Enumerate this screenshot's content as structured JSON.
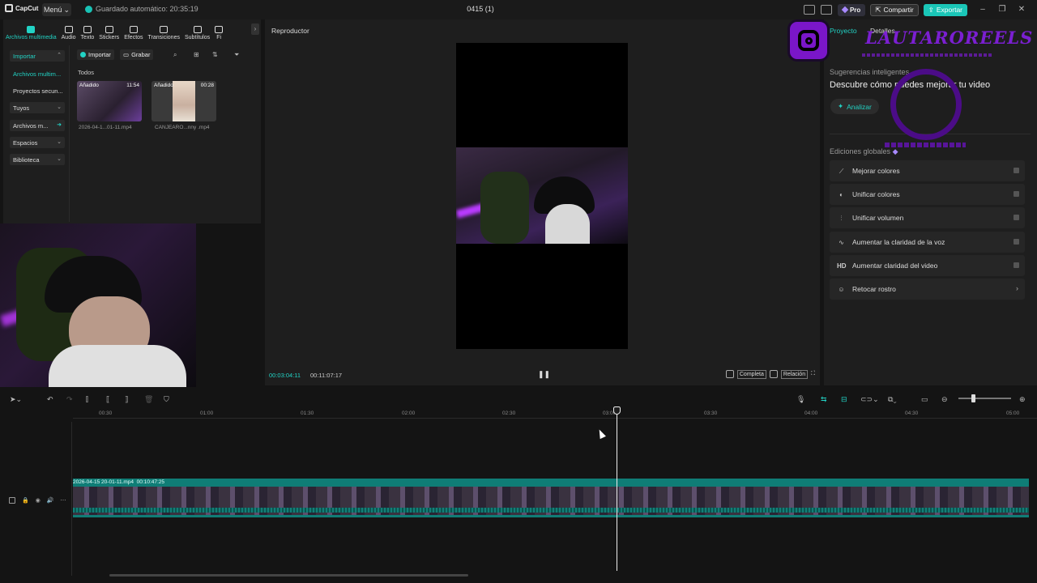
{
  "app": {
    "logo_text": "CapCut",
    "menu_label": "Menú",
    "autosave": "Guardado automático: 20:35:19",
    "doc_title": "0415 (1)",
    "pro_label": "Pro",
    "share_label": "Compartir",
    "export_label": "Exportar",
    "accent_color": "#22d3c5"
  },
  "tools": {
    "tabs": [
      {
        "label": "Archivos multimedia",
        "icon": "media-icon"
      },
      {
        "label": "Audio",
        "icon": "audio-icon"
      },
      {
        "label": "Texto",
        "icon": "text-icon"
      },
      {
        "label": "Stickers",
        "icon": "sticker-icon"
      },
      {
        "label": "Efectos",
        "icon": "effects-icon"
      },
      {
        "label": "Transiciones",
        "icon": "transitions-icon"
      },
      {
        "label": "Subtítulos",
        "icon": "subtitles-icon"
      },
      {
        "label": "Fi",
        "icon": "filters-icon"
      }
    ]
  },
  "sidebar": {
    "items": [
      {
        "label": "Importar"
      },
      {
        "label": "Archivos multim..."
      },
      {
        "label": "Proyectos secun..."
      },
      {
        "label": "Tuyos"
      },
      {
        "label": "Archivos m..."
      },
      {
        "label": "Espacios"
      },
      {
        "label": "Biblioteca"
      }
    ]
  },
  "media": {
    "import_label": "Importar",
    "record_label": "Grabar",
    "section_label": "Todos",
    "items": [
      {
        "tag": "Añadido",
        "duration": "11:54",
        "name": "2026-04-1...01-11.mp4"
      },
      {
        "tag": "Añadido",
        "duration": "00:28",
        "name": "CANJEARO...nny .mp4"
      }
    ]
  },
  "player": {
    "title": "Reproductor",
    "current_time": "00:03:04:11",
    "total_time": "00:11:07:17",
    "complete_label": "Completa",
    "ratio_label": "Relación"
  },
  "right_panel": {
    "tab_project": "Proyecto",
    "tab_details": "Detalles",
    "suggestions_title": "Sugerencias inteligentes",
    "suggestions_desc": "Descubre cómo puedes mejorar tu video",
    "analyze_label": "Analizar",
    "global_title": "Ediciones globales",
    "global_items": [
      {
        "label": "Mejorar colores"
      },
      {
        "label": "Unificar colores"
      },
      {
        "label": "Unificar volumen"
      },
      {
        "label": "Aumentar la claridad de la voz"
      },
      {
        "label": "Aumentar claridad del video"
      },
      {
        "label": "Retocar rostro"
      }
    ]
  },
  "overlay": {
    "brand_text": "LAUTAROREELS"
  },
  "timeline": {
    "ruler_labels": [
      "00:30",
      "01:00",
      "01:30",
      "02:00",
      "02:30",
      "03:00",
      "03:30",
      "04:00",
      "04:30",
      "05:00"
    ],
    "clip_name": "2026-04-15 20-01-11.mp4",
    "clip_duration": "00:10:47:25"
  }
}
